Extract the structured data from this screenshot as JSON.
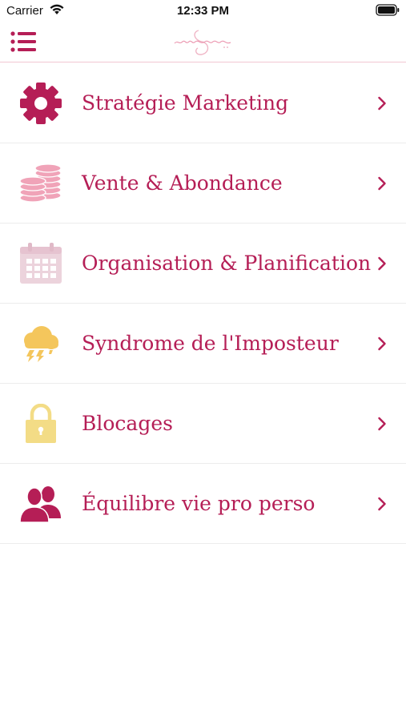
{
  "status_bar": {
    "carrier": "Carrier",
    "time": "12:33 PM",
    "icons": [
      "wifi-icon",
      "battery-icon"
    ]
  },
  "nav_bar": {
    "menu_icon": "hamburger-menu-icon",
    "logo_icon": "brand-logo-icon"
  },
  "colors": {
    "accent": "#b51e56",
    "pink_light": "#f0a3b8",
    "calendar_light": "#ecd3dc",
    "yellow": "#f4c65c",
    "lock_yellow": "#f3dc86",
    "separator": "#ececec"
  },
  "menu": {
    "items": [
      {
        "label": "Stratégie Marketing",
        "icon": "gear-icon"
      },
      {
        "label": "Vente & Abondance",
        "icon": "coins-stack-icon"
      },
      {
        "label": "Organisation & Planification",
        "icon": "calendar-icon"
      },
      {
        "label": "Syndrome de l'Imposteur",
        "icon": "storm-cloud-icon"
      },
      {
        "label": "Blocages",
        "icon": "padlock-icon"
      },
      {
        "label": "Équilibre vie pro perso",
        "icon": "users-icon"
      }
    ]
  }
}
